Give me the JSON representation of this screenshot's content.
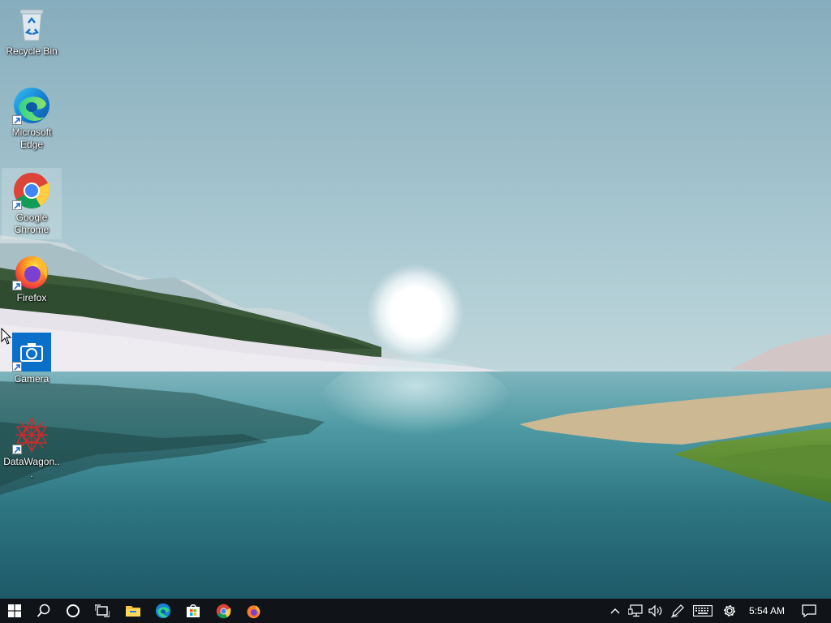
{
  "desktop": {
    "icons": [
      {
        "label": "Recycle Bin",
        "icon": "recycle-bin-icon"
      },
      {
        "label": "Microsoft Edge",
        "icon": "edge-icon"
      },
      {
        "label": "Google Chrome",
        "icon": "chrome-icon"
      },
      {
        "label": "Firefox",
        "icon": "firefox-icon"
      },
      {
        "label": "Camera",
        "icon": "camera-icon"
      },
      {
        "label": "DataWagon...",
        "icon": "datawagon-icon"
      }
    ]
  },
  "taskbar": {
    "pinned": [
      "windows-start-icon",
      "search-icon",
      "cortana-icon",
      "task-view-icon",
      "file-explorer-icon",
      "edge-icon",
      "store-icon",
      "chrome-icon",
      "firefox-icon"
    ],
    "tray": [
      "chevron-up-icon",
      "network-icon",
      "volume-icon",
      "pen-icon",
      "keyboard-icon",
      "settings-gear-icon"
    ],
    "clock": "5:54 AM",
    "notifications_icon": "action-center-icon"
  },
  "colors": {
    "taskbar_bg": "#101418",
    "sky_top": "#8fb4c2",
    "water": "#2c6f7a"
  }
}
